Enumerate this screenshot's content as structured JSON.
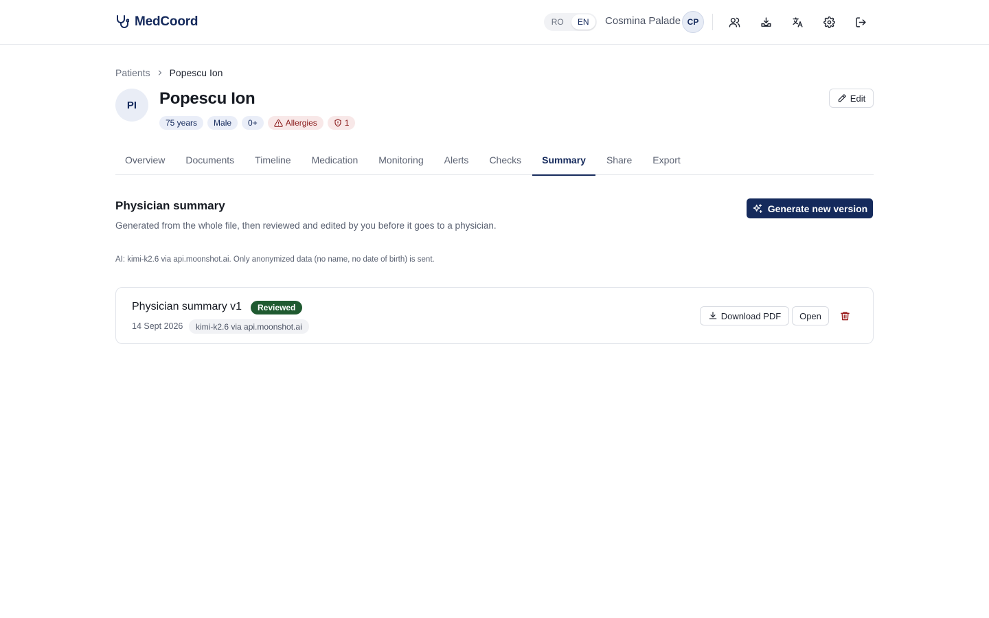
{
  "app": {
    "name": "MedCoord"
  },
  "header": {
    "languages": [
      "RO",
      "EN"
    ],
    "active_language": "EN",
    "user_name": "Cosmina Palade",
    "user_initials": "CP",
    "icons": [
      "users-icon",
      "inbox-download-icon",
      "translate-icon",
      "gear-icon",
      "logout-icon"
    ]
  },
  "breadcrumb": {
    "parent": "Patients",
    "current": "Popescu Ion"
  },
  "patient": {
    "initials": "PI",
    "name": "Popescu Ion",
    "age": "75 years",
    "sex": "Male",
    "blood_type": "0+",
    "allergies_label": "Allergies",
    "alert_count": "1",
    "edit_label": "Edit"
  },
  "tabs": [
    {
      "label": "Overview"
    },
    {
      "label": "Documents"
    },
    {
      "label": "Timeline"
    },
    {
      "label": "Medication"
    },
    {
      "label": "Monitoring"
    },
    {
      "label": "Alerts"
    },
    {
      "label": "Checks"
    },
    {
      "label": "Summary",
      "active": true
    },
    {
      "label": "Share"
    },
    {
      "label": "Export"
    }
  ],
  "summary": {
    "title": "Physician summary",
    "description": "Generated from the whole file, then reviewed and edited by you before it goes to a physician.",
    "ai_note": "AI: kimi-k2.6 via api.moonshot.ai. Only anonymized data (no name, no date of birth) is sent.",
    "generate_label": "Generate new version"
  },
  "versions": [
    {
      "title": "Physician summary v1",
      "status": "Reviewed",
      "date": "14 Sept 2026",
      "model": "kimi-k2.6 via api.moonshot.ai",
      "download_label": "Download PDF",
      "open_label": "Open"
    }
  ],
  "colors": {
    "brand": "#152a5c",
    "reviewed": "#1f5a30",
    "danger": "#9b1c1c",
    "allergy_bg": "#f8e8e8"
  }
}
